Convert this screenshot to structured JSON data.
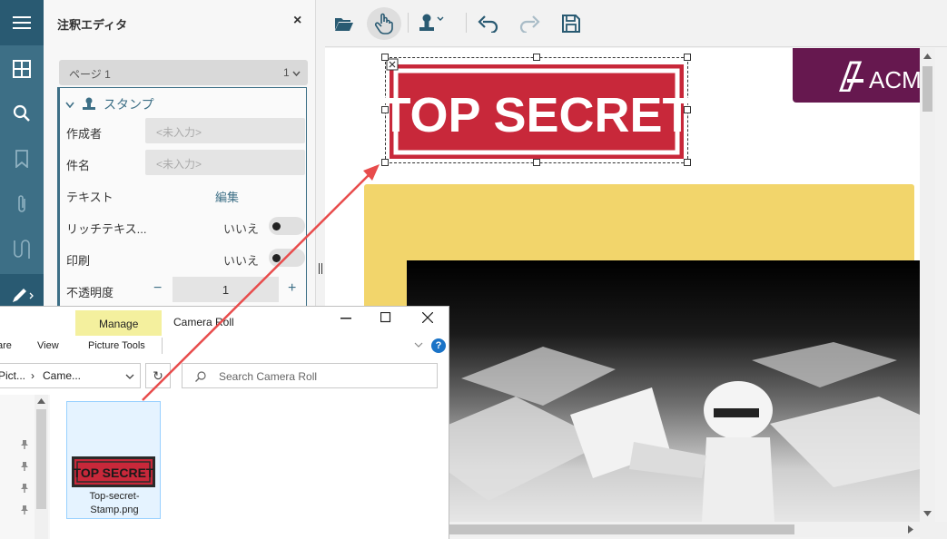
{
  "sidebar": {
    "title": "注釈エディタ",
    "close": "×",
    "page_select": {
      "label": "ページ 1",
      "value": "1"
    },
    "stamp": {
      "section_label": "スタンプ",
      "author_label": "作成者",
      "author_placeholder": "<未入力>",
      "subject_label": "件名",
      "subject_placeholder": "<未入力>",
      "text_label": "テキスト",
      "text_edit": "編集",
      "rich_text_label": "リッチテキス...",
      "rich_text_value": "いいえ",
      "print_label": "印刷",
      "print_value": "いいえ",
      "opacity_label": "不透明度",
      "opacity_value": "1",
      "minus": "−",
      "plus": "+"
    }
  },
  "document": {
    "stamp_text": "TOP SECRET",
    "logo_text": "ACM"
  },
  "explorer": {
    "title": "Camera Roll",
    "ribbon": {
      "manage": "Manage",
      "picture_tools": "Picture Tools",
      "view": "View",
      "share_partial": "are"
    },
    "address": {
      "crumb1": "Pict...",
      "crumb2": "Came..."
    },
    "search_placeholder": "Search Camera Roll",
    "file": {
      "name": "Top-secret-Stamp.png",
      "thumb_text": "TOP SECRET"
    },
    "help": "?"
  },
  "colors": {
    "accent": "#3d6f86",
    "stamp_red": "#c8283a",
    "yellow": "#f2d56b",
    "logo_purple": "#66184f",
    "arrow": "#e84c4c"
  }
}
